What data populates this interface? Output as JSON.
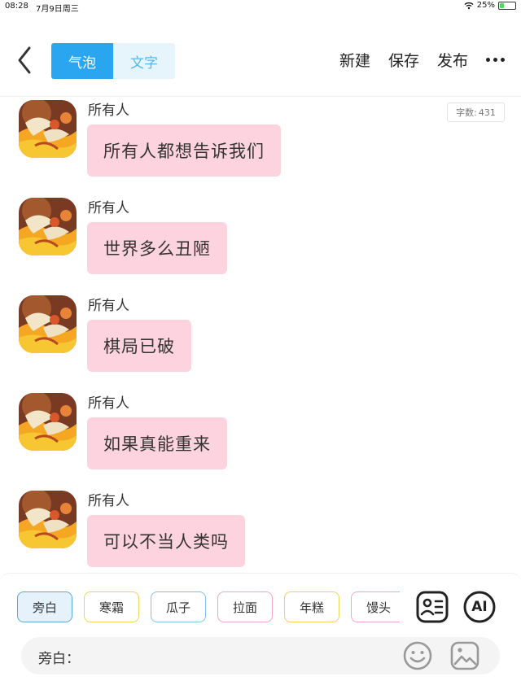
{
  "status_bar": {
    "time": "08:28",
    "date": "7月9日周三",
    "battery": "25%",
    "battery_level": 0.25
  },
  "header": {
    "tabs": [
      {
        "label": "气泡",
        "active": true
      },
      {
        "label": "文字",
        "active": false
      }
    ],
    "actions": {
      "new": "新建",
      "save": "保存",
      "publish": "发布"
    },
    "colors": {
      "accent": "#2aa6f0",
      "bubble": "#fcd3df"
    }
  },
  "word_count": {
    "label": "字数:",
    "value": "431"
  },
  "messages": [
    {
      "sender": "所有人",
      "text": "所有人都想告诉我们"
    },
    {
      "sender": "所有人",
      "text": "世界多么丑陋"
    },
    {
      "sender": "所有人",
      "text": "棋局已破"
    },
    {
      "sender": "所有人",
      "text": "如果真能重来"
    },
    {
      "sender": "所有人",
      "text": "可以不当人类吗"
    }
  ],
  "roles": [
    {
      "label": "旁白",
      "selected": true,
      "color": "#5aa9dd"
    },
    {
      "label": "寒霜",
      "selected": false,
      "color": "#f0d35a"
    },
    {
      "label": "瓜子",
      "selected": false,
      "color": "#7ec3ea"
    },
    {
      "label": "拉面",
      "selected": false,
      "color": "#f3a6c0"
    },
    {
      "label": "年糕",
      "selected": false,
      "color": "#f0d35a"
    },
    {
      "label": "馒头",
      "selected": false,
      "color": "#f3a6c0"
    }
  ],
  "tools": {
    "ai_label": "AI"
  },
  "input": {
    "label": "旁白："
  }
}
